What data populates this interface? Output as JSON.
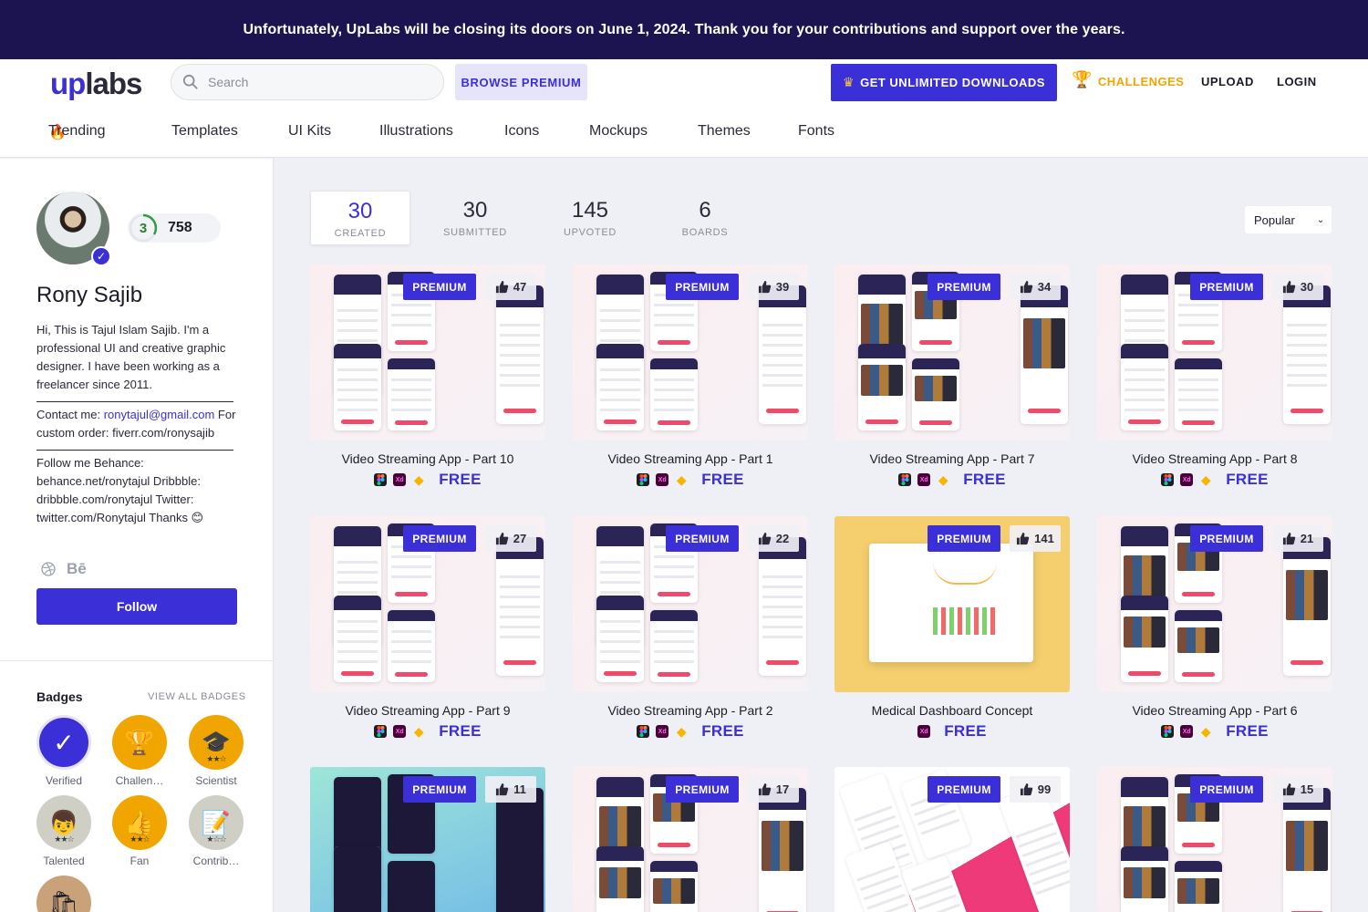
{
  "banner": {
    "text": "Unfortunately, UpLabs will be closing its doors on June 1, 2024. Thank you for your contributions and support over the years."
  },
  "header": {
    "logo_up": "up",
    "logo_labs": "labs",
    "search_placeholder": "Search",
    "browse_premium": "BROWSE PREMIUM",
    "unlimited": "GET UNLIMITED DOWNLOADS",
    "challenges": "CHALLENGES",
    "upload": "UPLOAD",
    "login": "LOGIN"
  },
  "categories": [
    "Trending",
    "Templates",
    "UI Kits",
    "Illustrations",
    "Icons",
    "Mockups",
    "Themes",
    "Fonts"
  ],
  "profile": {
    "level": "3",
    "points": "758",
    "name": "Rony Sajib",
    "bio_intro": "Hi, This is Tajul Islam Sajib. I'm a professional UI and creative graphic designer. I have been working as a freelancer since 2011.",
    "contact_prefix": "Contact me: ",
    "contact_email": "ronytajul@gmail.com",
    "contact_suffix": " For custom order: fiverr.com/ronysajib",
    "follow_text": "Follow me Behance: behance.net/ronytajul Dribbble: dribbble.com/ronytajul Twitter: twitter.com/Ronytajul Thanks 😊",
    "behance_label": "Bē",
    "follow_button": "Follow"
  },
  "badges": {
    "title": "Badges",
    "view_all": "VIEW ALL BADGES",
    "items": [
      {
        "label": "Verified",
        "icon": "check-icon",
        "color": "#3b2fd8"
      },
      {
        "label": "Challen…",
        "icon": "trophy-icon",
        "color": "#f0a500"
      },
      {
        "label": "Scientist",
        "icon": "graduation-cap-icon",
        "color": "#f0a500"
      },
      {
        "label": "Talented",
        "icon": "face-icon",
        "color": "#cfcfc6"
      },
      {
        "label": "Fan",
        "icon": "thumbs-up-icon",
        "color": "#f0a500"
      },
      {
        "label": "Contrib…",
        "icon": "pencil-icon",
        "color": "#cfcfc6"
      }
    ]
  },
  "stats": [
    {
      "value": "30",
      "label": "CREATED"
    },
    {
      "value": "30",
      "label": "SUBMITTED"
    },
    {
      "value": "145",
      "label": "UPVOTED"
    },
    {
      "value": "6",
      "label": "BOARDS"
    }
  ],
  "sort": {
    "selected": "Popular"
  },
  "cards": [
    {
      "title": "Video Streaming App - Part 10",
      "likes": "47",
      "premium": "PREMIUM",
      "price": "FREE",
      "tools": [
        "figma",
        "xd",
        "sketch"
      ]
    },
    {
      "title": "Video Streaming App - Part 1",
      "likes": "39",
      "premium": "PREMIUM",
      "price": "FREE",
      "tools": [
        "figma",
        "xd",
        "sketch"
      ]
    },
    {
      "title": "Video Streaming App - Part 7",
      "likes": "34",
      "premium": "PREMIUM",
      "price": "FREE",
      "tools": [
        "figma",
        "xd",
        "sketch"
      ]
    },
    {
      "title": "Video Streaming App - Part 8",
      "likes": "30",
      "premium": "PREMIUM",
      "price": "FREE",
      "tools": [
        "figma",
        "xd",
        "sketch"
      ]
    },
    {
      "title": "Video Streaming App - Part 9",
      "likes": "27",
      "premium": "PREMIUM",
      "price": "FREE",
      "tools": [
        "figma",
        "xd",
        "sketch"
      ]
    },
    {
      "title": "Video Streaming App - Part 2",
      "likes": "22",
      "premium": "PREMIUM",
      "price": "FREE",
      "tools": [
        "figma",
        "xd",
        "sketch"
      ]
    },
    {
      "title": "Medical Dashboard Concept",
      "likes": "141",
      "premium": "PREMIUM",
      "price": "FREE",
      "tools": [
        "xd"
      ]
    },
    {
      "title": "Video Streaming App - Part 6",
      "likes": "21",
      "premium": "PREMIUM",
      "price": "FREE",
      "tools": [
        "figma",
        "xd",
        "sketch"
      ]
    },
    {
      "title": "",
      "likes": "11",
      "premium": "PREMIUM",
      "price": "",
      "tools": []
    },
    {
      "title": "",
      "likes": "17",
      "premium": "PREMIUM",
      "price": "",
      "tools": []
    },
    {
      "title": "",
      "likes": "99",
      "premium": "PREMIUM",
      "price": "",
      "tools": []
    },
    {
      "title": "",
      "likes": "15",
      "premium": "PREMIUM",
      "price": "",
      "tools": []
    }
  ],
  "colors": {
    "accent": "#3b2fd8",
    "banner": "#1c1450",
    "challenges": "#f0a500"
  }
}
